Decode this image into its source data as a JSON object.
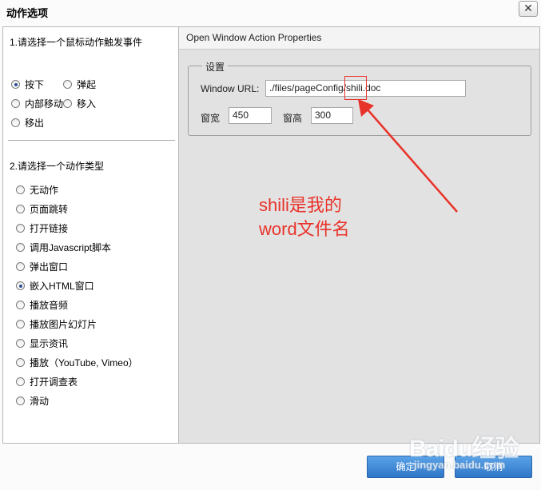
{
  "window": {
    "title": "动作选项",
    "close_glyph": "✕"
  },
  "left": {
    "section1_title": "1.请选择一个鼠标动作触发事件",
    "triggers": [
      {
        "label": "按下",
        "checked": true
      },
      {
        "label": "弹起",
        "checked": false
      },
      {
        "label": "内部移动",
        "checked": false
      },
      {
        "label": "移入",
        "checked": false
      },
      {
        "label": "移出",
        "checked": false
      }
    ],
    "section2_title": "2.请选择一个动作类型",
    "actions": [
      {
        "label": "无动作",
        "checked": false
      },
      {
        "label": "页面跳转",
        "checked": false
      },
      {
        "label": "打开链接",
        "checked": false
      },
      {
        "label": "调用Javascript脚本",
        "checked": false
      },
      {
        "label": "弹出窗口",
        "checked": false
      },
      {
        "label": "嵌入HTML窗口",
        "checked": true
      },
      {
        "label": "播放音频",
        "checked": false
      },
      {
        "label": "播放图片幻灯片",
        "checked": false
      },
      {
        "label": "显示资讯",
        "checked": false
      },
      {
        "label": "播放（YouTube, Vimeo）",
        "checked": false
      },
      {
        "label": "打开调查表",
        "checked": false
      },
      {
        "label": "滑动",
        "checked": false
      }
    ]
  },
  "right": {
    "header": "Open Window Action Properties",
    "group_legend": "设置",
    "url_label": "Window URL:",
    "url_value": "./files/pageConfig/shili.doc",
    "width_label": "窗宽",
    "width_value": "450",
    "height_label": "窗高",
    "height_value": "300"
  },
  "annotation": {
    "line1": "shili是我的",
    "line2": "word文件名",
    "color": "#e8332a"
  },
  "buttons": {
    "ok": "确定",
    "cancel": "取消"
  },
  "watermark": {
    "brand": "Baidu经验",
    "sub": "jingyan.baidu.com"
  },
  "colors": {
    "accent_button": "#2f77c8",
    "annotation_red": "#e8332a"
  }
}
